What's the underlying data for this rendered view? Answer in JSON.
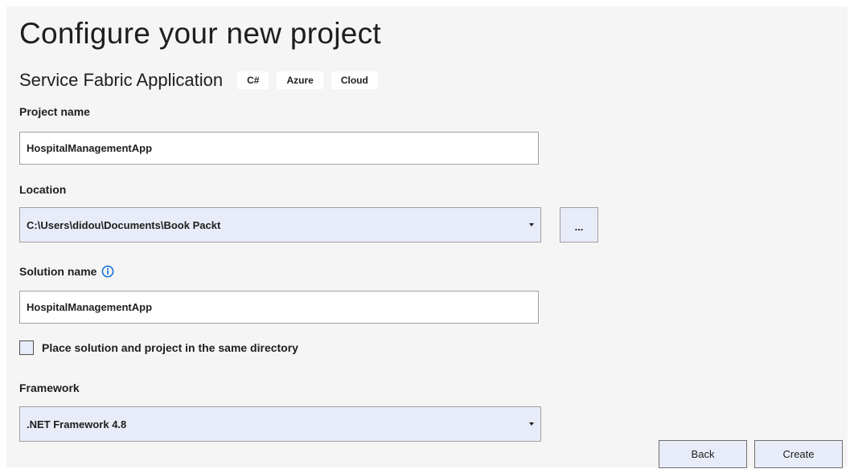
{
  "page": {
    "title": "Configure your new project"
  },
  "template": {
    "name": "Service Fabric Application",
    "tags": [
      "C#",
      "Azure",
      "Cloud"
    ]
  },
  "project_name": {
    "label": "Project name",
    "value": "HospitalManagementApp"
  },
  "location": {
    "label": "Location",
    "value": "C:\\Users\\didou\\Documents\\Book Packt",
    "browse_label": "...",
    "arrow_icon": "chevron-down-icon"
  },
  "solution_name": {
    "label": "Solution name",
    "info_icon": "info-icon",
    "value": "HospitalManagementApp"
  },
  "same_directory": {
    "label": "Place solution and project in the same directory",
    "checked": false
  },
  "framework": {
    "label": "Framework",
    "value": ".NET Framework 4.8",
    "arrow_icon": "chevron-down-icon"
  },
  "buttons": {
    "back": "Back",
    "create": "Create"
  },
  "colors": {
    "panel_bg": "#f5f5f5",
    "control_bg": "#e8ecf8",
    "info_accent": "#1a73d9",
    "text": "#1e1e1e"
  }
}
